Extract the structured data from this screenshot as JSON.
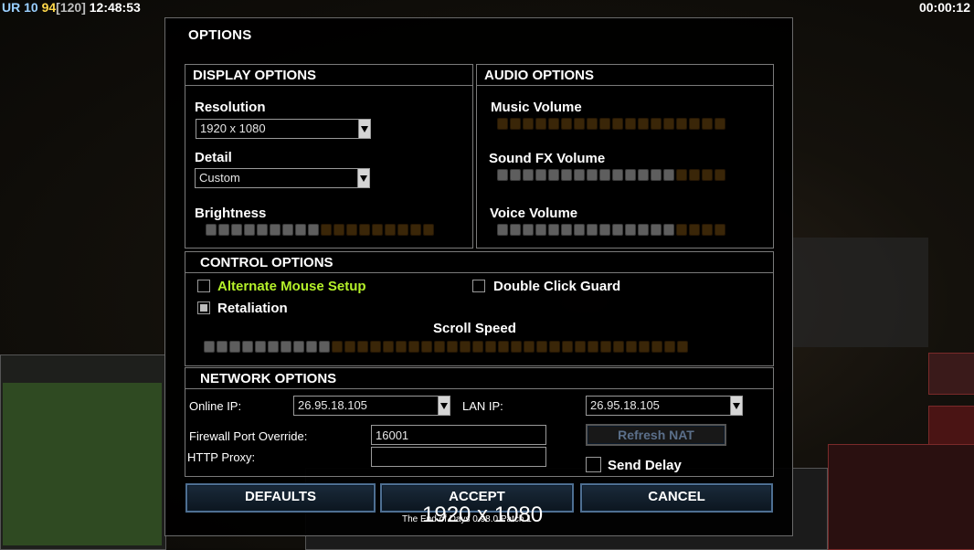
{
  "hud": {
    "ur": "UR",
    "level": "10",
    "fps": "94",
    "fps_cap": "[120]",
    "clock": "12:48:53",
    "game_timer": "00:00:12"
  },
  "dialog": {
    "title": "OPTIONS",
    "display": {
      "header": "DISPLAY OPTIONS",
      "resolution_label": "Resolution",
      "resolution_value": "1920 x 1080",
      "detail_label": "Detail",
      "detail_value": "Custom",
      "brightness_label": "Brightness",
      "brightness_level": 0.5
    },
    "audio": {
      "header": "AUDIO OPTIONS",
      "music_label": "Music Volume",
      "music_level": 0,
      "sfx_label": "Sound FX Volume",
      "sfx_level": 0.75,
      "voice_label": "Voice Volume",
      "voice_level": 0.75
    },
    "control": {
      "header": "CONTROL OPTIONS",
      "alt_mouse_label": "Alternate Mouse Setup",
      "alt_mouse_checked": false,
      "double_click_label": "Double Click Guard",
      "double_click_checked": false,
      "retaliation_label": "Retaliation",
      "retaliation_checked": true,
      "scroll_speed_label": "Scroll Speed",
      "scroll_speed_level": 0.26
    },
    "network": {
      "header": "NETWORK OPTIONS",
      "online_ip_label": "Online IP:",
      "online_ip_value": "26.95.18.105",
      "lan_ip_label": "LAN IP:",
      "lan_ip_value": "26.95.18.105",
      "firewall_label": "Firewall Port Override:",
      "firewall_value": "16001",
      "proxy_label": "HTTP Proxy:",
      "proxy_value": "",
      "refresh_nat_label": "Refresh NAT",
      "send_delay_label": "Send Delay",
      "send_delay_checked": false
    },
    "buttons": {
      "defaults": "DEFAULTS",
      "accept": "ACCEPT",
      "cancel": "CANCEL"
    }
  },
  "overlay": {
    "resolution_text": "1920 x 1080",
    "version_text": "The End of Days 0.98.0 Patch 1"
  },
  "colors": {
    "accent_green": "#b4f02a",
    "slider_on": "#5e5e5e",
    "slider_off": "#3a2608",
    "button_border": "#4e6f92"
  }
}
